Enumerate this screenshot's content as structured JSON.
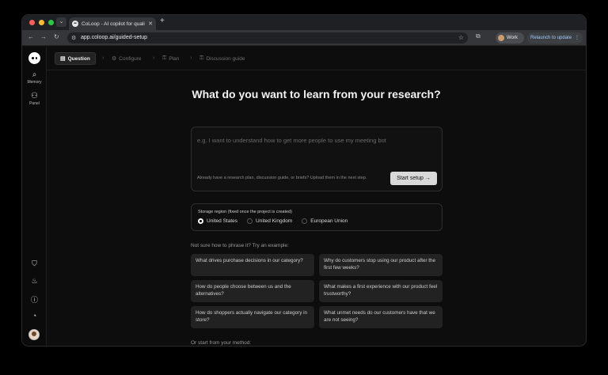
{
  "browser": {
    "tab_title": "CoLoop - AI copilot for qualitative research",
    "url": "app.coloop.ai/guided-setup",
    "profile_label": "Work",
    "relaunch_label": "Relaunch to update",
    "traffic_lights": [
      "#ff5f57",
      "#febc2e",
      "#28c840"
    ]
  },
  "sidebar": {
    "items": [
      {
        "icon": "search-icon",
        "label": "Memory"
      },
      {
        "icon": "users-icon",
        "label": "Panel"
      }
    ],
    "bottom_icons": [
      "shield-icon",
      "flame-icon",
      "help-icon",
      "clock-icon",
      "avatar"
    ]
  },
  "steps": [
    {
      "label": "Question",
      "icon": "document-icon",
      "active": true
    },
    {
      "label": "Configure",
      "icon": "settings-icon",
      "active": false
    },
    {
      "label": "Plan",
      "icon": "lock-icon",
      "active": false
    },
    {
      "label": "Discussion guide",
      "icon": "lock-icon",
      "active": false
    }
  ],
  "main": {
    "heading": "What do you want to learn from your research?",
    "question_placeholder": "e.g. I want to understand how to get more people to use my meeting bot",
    "question_hint": "Already have a research plan, discussion guide, or briefs? Upload them in the next step.",
    "start_button": "Start setup →",
    "region_label": "Storage region (fixed once the project is created)",
    "regions": [
      {
        "label": "United States",
        "selected": true
      },
      {
        "label": "United Kingdom",
        "selected": false
      },
      {
        "label": "European Union",
        "selected": false
      }
    ],
    "examples_label": "Not sure how to phrase it? Try an example:",
    "examples": [
      "What drives purchase decisions in our category?",
      "Why do customers stop using our product after the first few weeks?",
      "How do people choose between us and the alternatives?",
      "What makes a first experience with our product feel trustworthy?",
      "How do shoppers actually navigate our category in store?",
      "What unmet needs do our customers have that we are not seeing?"
    ],
    "method_label": "Or start from your method:"
  }
}
